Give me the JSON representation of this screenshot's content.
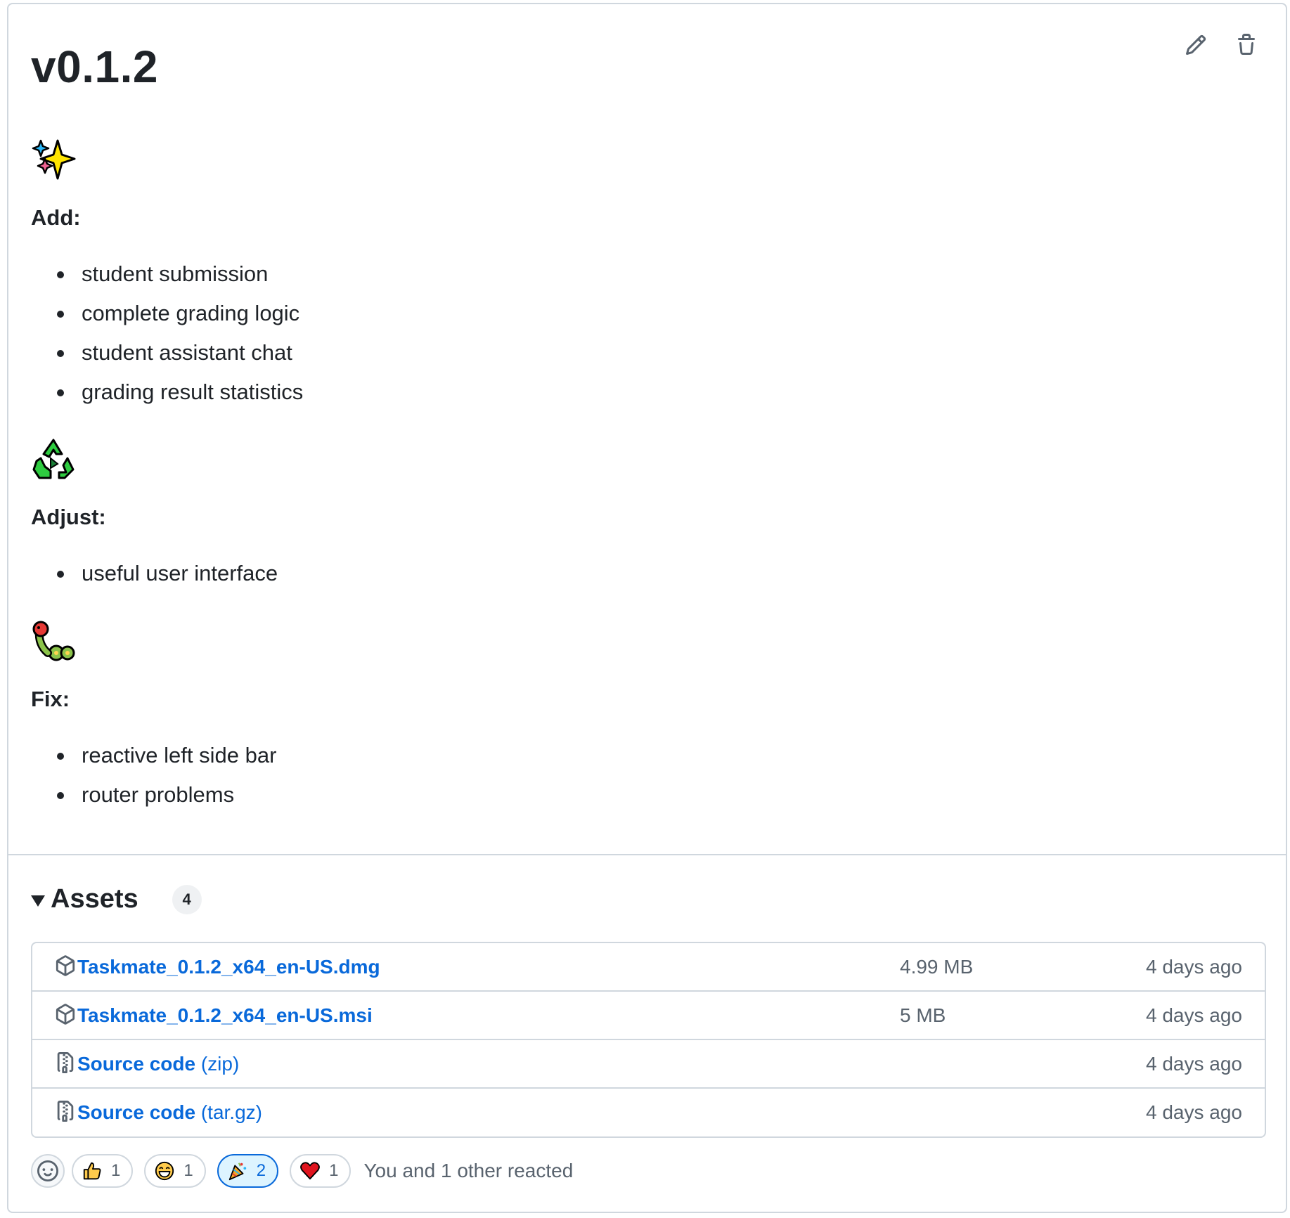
{
  "release": {
    "title": "v0.1.2",
    "sections": [
      {
        "emoji": "sparkles-emoji",
        "label": "Add:",
        "items": [
          "student submission",
          "complete grading logic",
          "student assistant chat",
          "grading result statistics"
        ]
      },
      {
        "emoji": "recycle-emoji",
        "label": "Adjust:",
        "items": [
          "useful user interface"
        ]
      },
      {
        "emoji": "bug-emoji",
        "label": "Fix:",
        "items": [
          "reactive left side bar",
          "router problems"
        ]
      }
    ]
  },
  "actions": {
    "edit_icon": "pencil-icon",
    "delete_icon": "trash-icon"
  },
  "assets": {
    "title": "Assets",
    "count": "4",
    "rows": [
      {
        "icon": "package-icon",
        "name": "Taskmate_0.1.2_x64_en-US.dmg",
        "ext": "",
        "size": "4.99 MB",
        "date": "4 days ago"
      },
      {
        "icon": "package-icon",
        "name": "Taskmate_0.1.2_x64_en-US.msi",
        "ext": "",
        "size": "5 MB",
        "date": "4 days ago"
      },
      {
        "icon": "file-zip-icon",
        "name": "Source code",
        "ext": " (zip)",
        "size": "",
        "date": "4 days ago"
      },
      {
        "icon": "file-zip-icon",
        "name": "Source code",
        "ext": " (tar.gz)",
        "size": "",
        "date": "4 days ago"
      }
    ]
  },
  "reactions": {
    "items": [
      {
        "emoji": "thumbs-up-emoji",
        "count": "1"
      },
      {
        "emoji": "laugh-emoji",
        "count": "1"
      },
      {
        "emoji": "hooray-emoji",
        "count": "2"
      },
      {
        "emoji": "heart-emoji",
        "count": "1"
      }
    ],
    "summary": "You and 1 other reacted"
  },
  "colors": {
    "link": "#0969da",
    "border": "#d0d7de",
    "muted": "#59636e",
    "text": "#1f2328"
  }
}
